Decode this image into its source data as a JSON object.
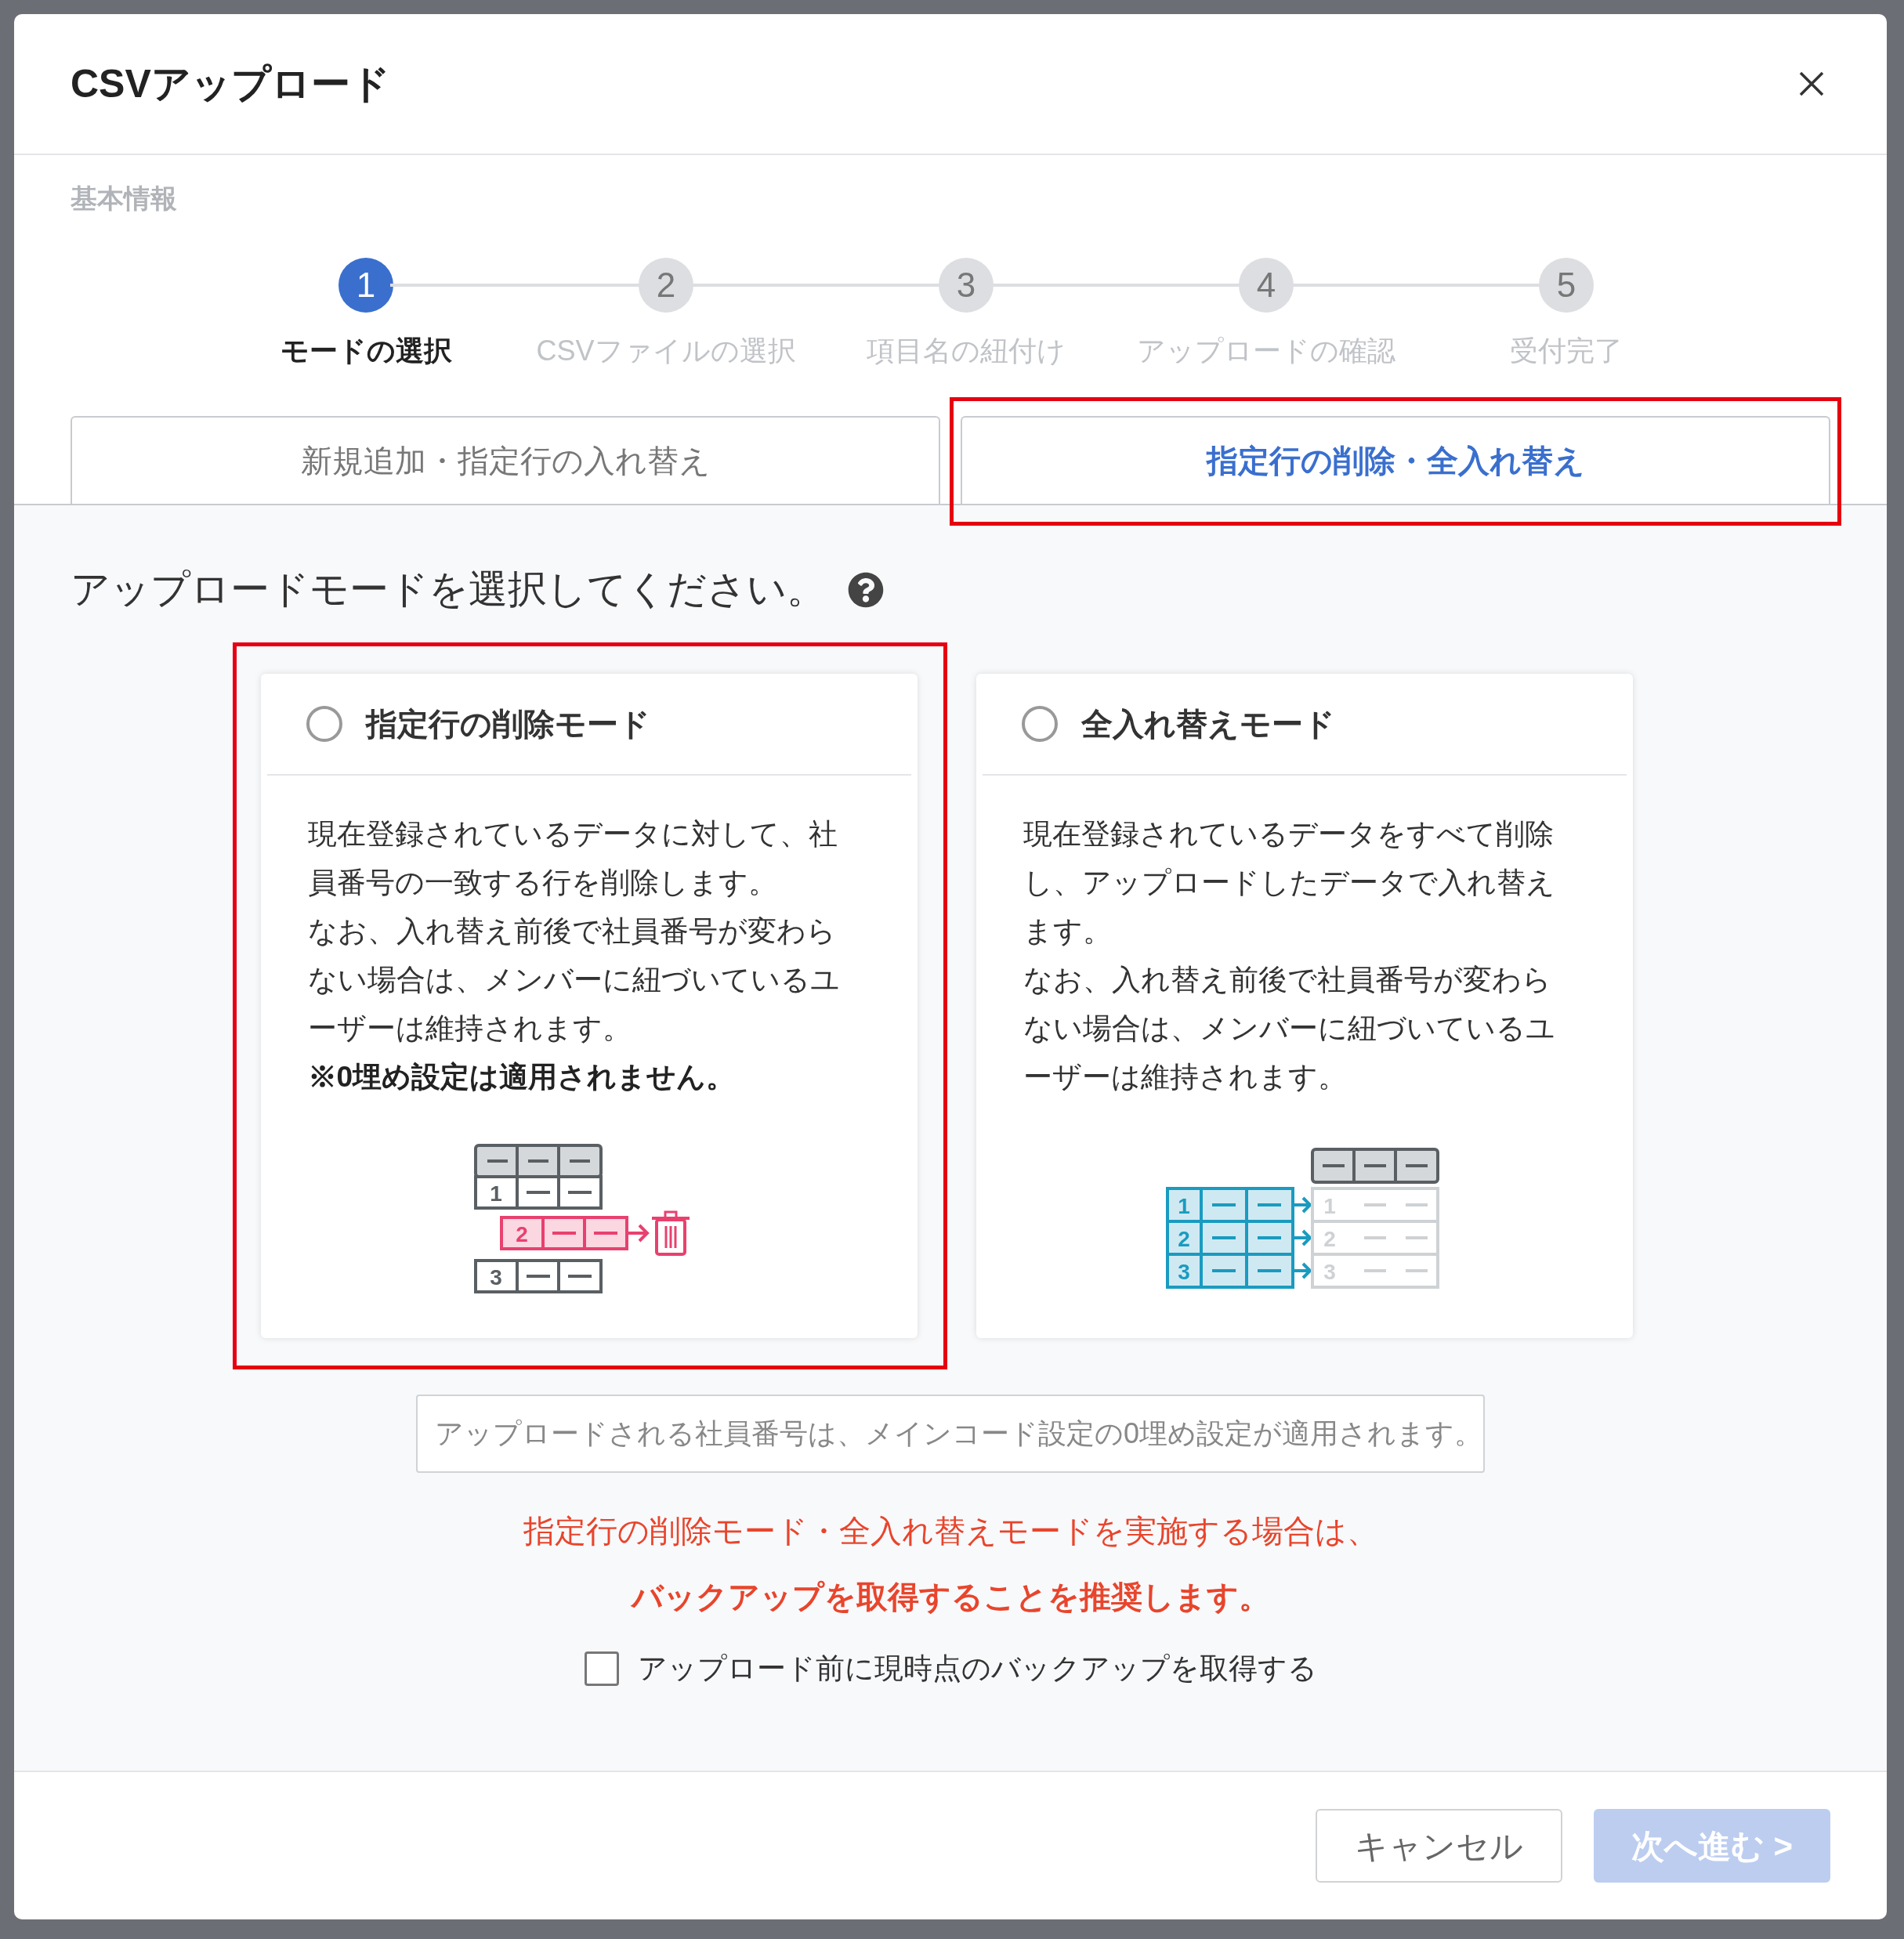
{
  "dialog": {
    "title": "CSVアップロード",
    "section_label": "基本情報"
  },
  "steps": [
    {
      "number": "1",
      "label": "モードの選択",
      "selected": true
    },
    {
      "number": "2",
      "label": "CSVファイルの選択",
      "selected": false
    },
    {
      "number": "3",
      "label": "項目名の紐付け",
      "selected": false
    },
    {
      "number": "4",
      "label": "アップロードの確認",
      "selected": false
    },
    {
      "number": "5",
      "label": "受付完了",
      "selected": false
    }
  ],
  "tabs": [
    {
      "label": "新規追加・指定行の入れ替え",
      "selected": false,
      "highlighted": false
    },
    {
      "label": "指定行の削除・全入れ替え",
      "selected": true,
      "highlighted": true
    }
  ],
  "prompt": "アップロードモードを選択してください。",
  "cards": [
    {
      "title": "指定行の削除モード",
      "selected": false,
      "highlighted": true,
      "description": [
        "現在登録されているデータに対して、社員番号の一致する行を削除します。",
        "なお、入れ替え前後で社員番号が変わらない場合は、メンバーに紐づいているユーザーは維持されます。"
      ],
      "note": "※0埋め設定は適用されません。",
      "illustration": {
        "kind": "delete",
        "rows": [
          "1",
          "2",
          "3"
        ]
      }
    },
    {
      "title": "全入れ替えモード",
      "selected": false,
      "highlighted": false,
      "description": [
        "現在登録されているデータをすべて削除し、アップロードしたデータで入れ替えます。",
        "なお、入れ替え前後で社員番号が変わらない場合は、メンバーに紐づいているユーザーは維持されます。"
      ],
      "illustration": {
        "kind": "replace",
        "rows": [
          "1",
          "2",
          "3"
        ],
        "target_rows": [
          "1",
          "2",
          "3"
        ]
      }
    }
  ],
  "info": "アップロードされる社員番号は、メインコード設定の0埋め設定が適用されます。",
  "warning": [
    "指定行の削除モード・全入れ替えモードを実施する場合は、",
    "バックアップを取得することを推奨します。"
  ],
  "backup": {
    "label": "アップロード前に現時点のバックアップを取得する",
    "checked": false
  },
  "buttons": [
    {
      "label": "キャンセル",
      "kind": "secondary",
      "disabled": false
    },
    {
      "label": "次へ進む >",
      "kind": "primary",
      "disabled": true
    }
  ]
}
